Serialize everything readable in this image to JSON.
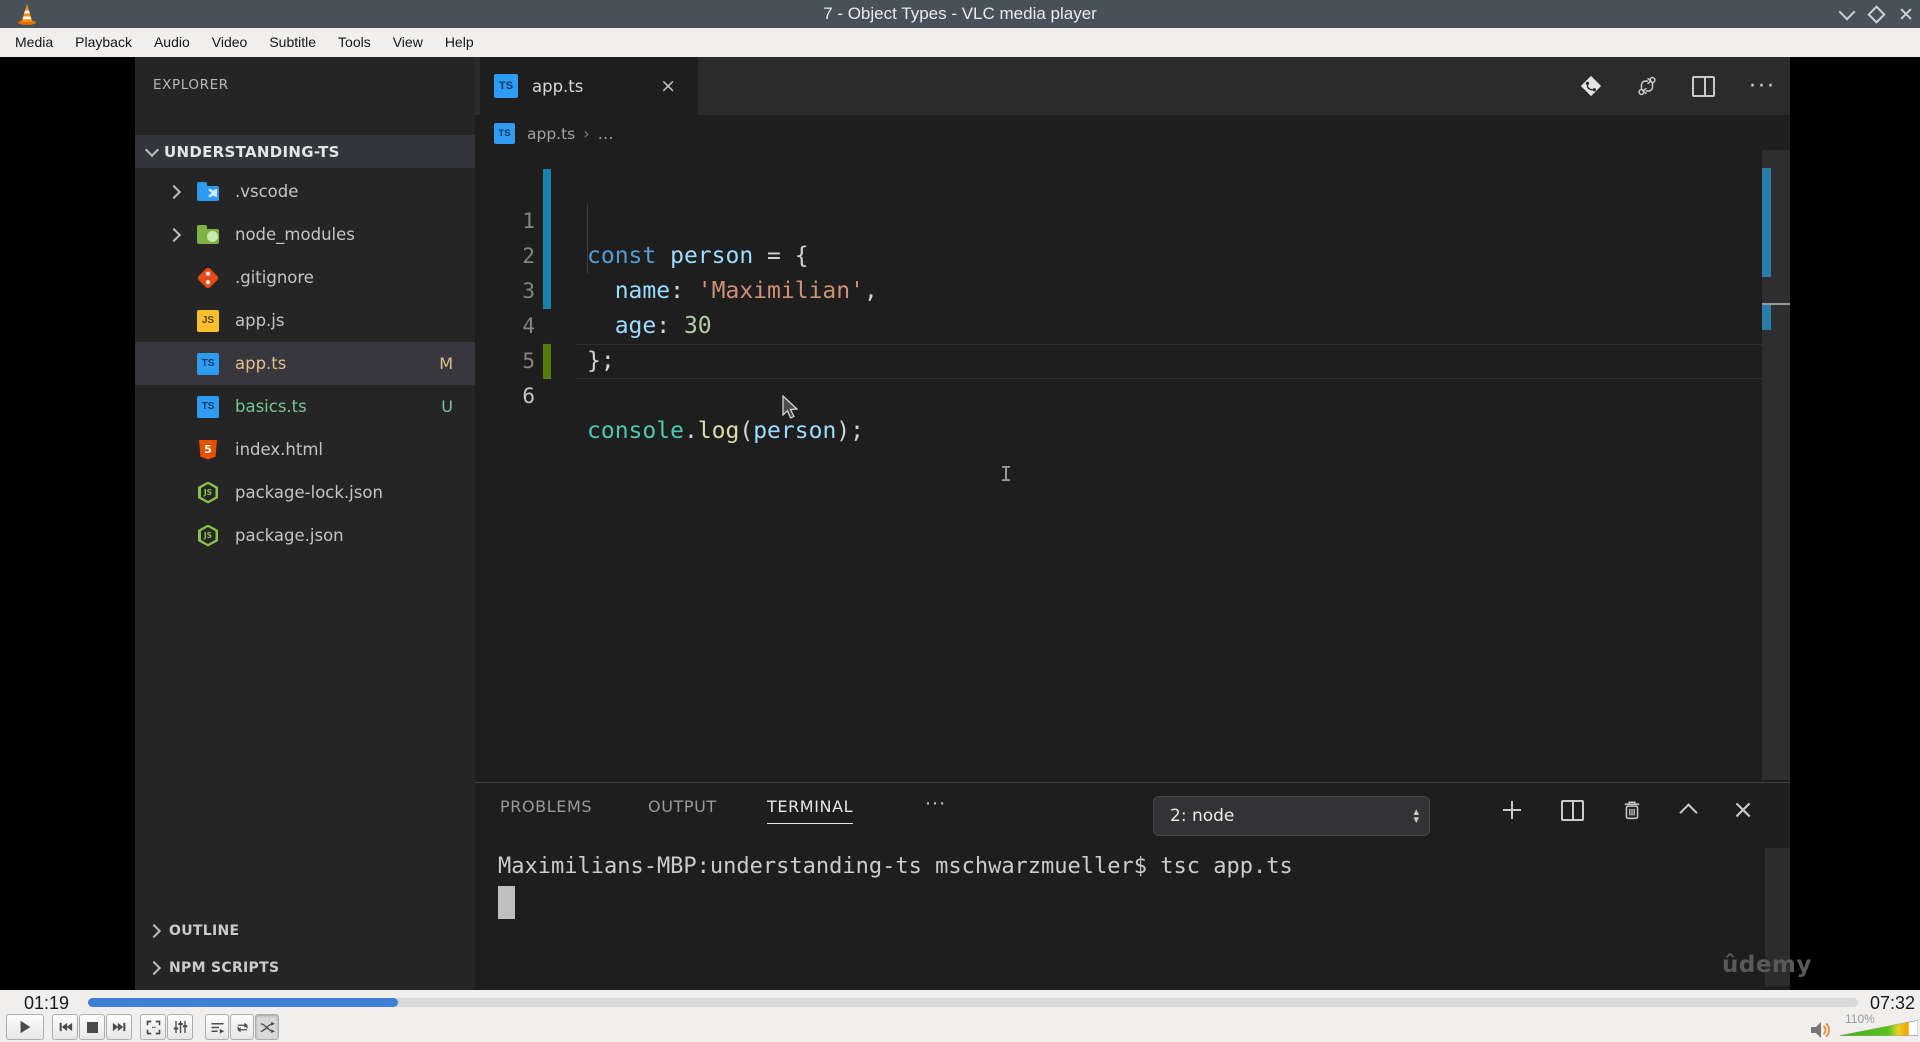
{
  "vlc": {
    "window_title": "7 - Object Types - VLC media player",
    "menu": [
      "Media",
      "Playback",
      "Audio",
      "Video",
      "Subtitle",
      "Tools",
      "View",
      "Help"
    ],
    "time_elapsed": "01:19",
    "time_total": "07:32",
    "progress_pct": 17.5,
    "volume_label": "110%",
    "accent_blue": "#3d7fd6"
  },
  "glyphs": {
    "tab_close": "×",
    "panel_close": "×",
    "ellipsis": "···",
    "panel_more": "···",
    "breadcrumb_sep": "›",
    "breadcrumb_more": "…",
    "select_up": "▴",
    "select_down": "▾",
    "ibeam": "I"
  },
  "icon_labels": {
    "ts": "TS",
    "js": "JS",
    "html": "5",
    "node": "JS"
  },
  "vscode": {
    "explorer": {
      "title": "EXPLORER",
      "root": "UNDERSTANDING-TS",
      "files": [
        {
          "name": ".vscode",
          "badge": ""
        },
        {
          "name": "node_modules",
          "badge": ""
        },
        {
          "name": ".gitignore",
          "badge": ""
        },
        {
          "name": "app.js",
          "badge": ""
        },
        {
          "name": "app.ts",
          "badge": "M"
        },
        {
          "name": "basics.ts",
          "badge": "U"
        },
        {
          "name": "index.html",
          "badge": ""
        },
        {
          "name": "package-lock.json",
          "badge": ""
        },
        {
          "name": "package.json",
          "badge": ""
        }
      ],
      "sections": [
        {
          "label": "OUTLINE"
        },
        {
          "label": "NPM SCRIPTS"
        }
      ]
    },
    "tab": {
      "label": "app.ts"
    },
    "breadcrumb": {
      "file": "app.ts"
    },
    "code": {
      "lines": [
        {
          "num": "1",
          "segs": [
            {
              "t": "const"
            },
            {
              "t": " "
            },
            {
              "t": "person"
            },
            {
              "t": " = {"
            }
          ]
        },
        {
          "num": "2",
          "segs": [
            {
              "t": "  "
            },
            {
              "t": "name"
            },
            {
              "t": ": "
            },
            {
              "t": "'Maximilian'"
            },
            {
              "t": ","
            }
          ]
        },
        {
          "num": "3",
          "segs": [
            {
              "t": "  "
            },
            {
              "t": "age"
            },
            {
              "t": ": "
            },
            {
              "t": "30"
            }
          ]
        },
        {
          "num": "4",
          "segs": [
            {
              "t": "};"
            }
          ]
        },
        {
          "num": "5",
          "segs": []
        },
        {
          "num": "6",
          "segs": [
            {
              "t": "console"
            },
            {
              "t": "."
            },
            {
              "t": "log"
            },
            {
              "t": "("
            },
            {
              "t": "person"
            },
            {
              "t": ");"
            }
          ]
        }
      ]
    },
    "panel": {
      "tabs": [
        {
          "label": "PROBLEMS"
        },
        {
          "label": "OUTPUT"
        },
        {
          "label": "TERMINAL"
        }
      ],
      "active_tab": "TERMINAL",
      "shell_select": "2: node",
      "terminal_line": "Maximilians-MBP:understanding-ts mschwarzmueller$ tsc app.ts"
    },
    "watermark": "ûdemy"
  }
}
